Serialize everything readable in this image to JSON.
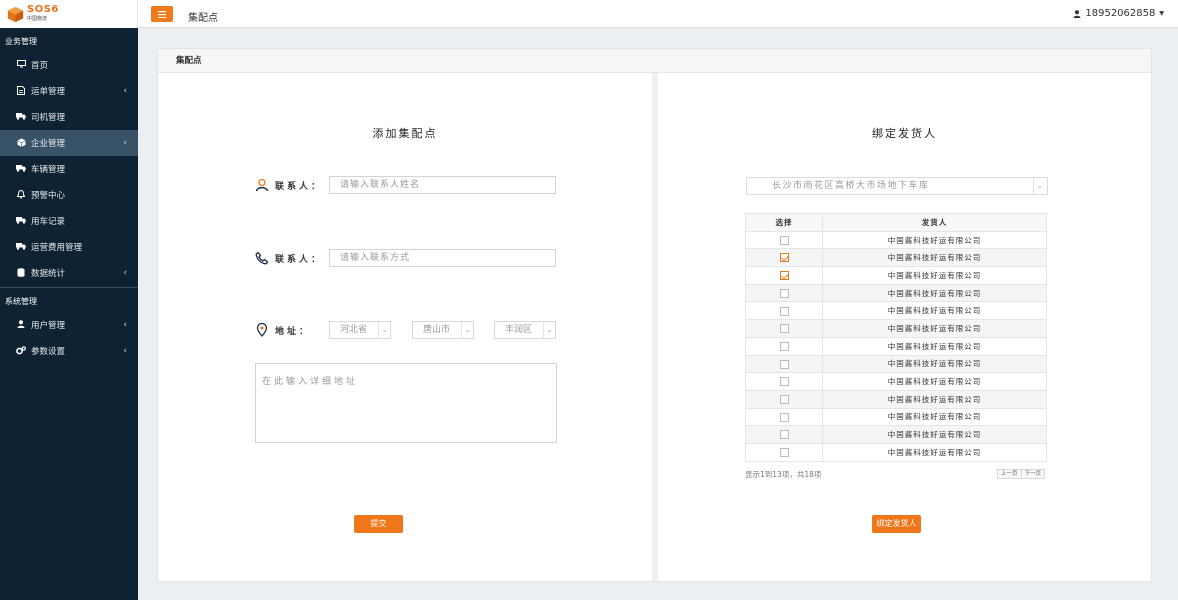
{
  "brand": {
    "logo_text": "SOS6",
    "logo_sub": "中国物流",
    "accent": "#f0761a",
    "sidebar_bg": "#0f2233"
  },
  "header": {
    "page_title": "集配点",
    "user": "18952062858"
  },
  "sidebar": {
    "section_business": "业务管理",
    "business_items": [
      {
        "label": "首页",
        "icon": "monitor-icon",
        "has_arrow": false
      },
      {
        "label": "运单管理",
        "icon": "document-icon",
        "has_arrow": true
      },
      {
        "label": "司机管理",
        "icon": "truck-icon",
        "has_arrow": false
      },
      {
        "label": "企业管理",
        "icon": "cube-icon",
        "has_arrow": true,
        "active": true
      },
      {
        "label": "车辆管理",
        "icon": "truck-icon",
        "has_arrow": false
      },
      {
        "label": "预警中心",
        "icon": "bell-icon",
        "has_arrow": false
      },
      {
        "label": "用车记录",
        "icon": "truck-icon",
        "has_arrow": false
      },
      {
        "label": "运营费用管理",
        "icon": "truck-icon",
        "has_arrow": false
      },
      {
        "label": "数据统计",
        "icon": "database-icon",
        "has_arrow": true
      }
    ],
    "section_system": "系统管理",
    "system_items": [
      {
        "label": "用户管理",
        "icon": "user-icon",
        "has_arrow": true
      },
      {
        "label": "参数设置",
        "icon": "gears-icon",
        "has_arrow": true
      }
    ],
    "arrow": "‹"
  },
  "card": {
    "header": "集配点"
  },
  "left_panel": {
    "title": "添加集配点",
    "contact_name_label": "联系人：",
    "contact_name_placeholder": "请输入联系人姓名",
    "contact_phone_label": "联系人：",
    "contact_phone_placeholder": "请输入联系方式",
    "address_label": "地址：",
    "province": "河北省",
    "city": "唐山市",
    "district": "丰润区",
    "detail_placeholder": "在此输入详细地址",
    "submit_label": "提交"
  },
  "right_panel": {
    "title": "绑定发货人",
    "location": "长沙市雨花区高桥大市场地下车库",
    "col_select": "选择",
    "col_shipper": "发货人",
    "rows": [
      {
        "name": "中国酱科技好运有限公司",
        "checked": false
      },
      {
        "name": "中国酱科技好运有限公司",
        "checked": true
      },
      {
        "name": "中国酱科技好运有限公司",
        "checked": true
      },
      {
        "name": "中国酱科技好运有限公司",
        "checked": false
      },
      {
        "name": "中国酱科技好运有限公司",
        "checked": false
      },
      {
        "name": "中国酱科技好运有限公司",
        "checked": false
      },
      {
        "name": "中国酱科技好运有限公司",
        "checked": false
      },
      {
        "name": "中国酱科技好运有限公司",
        "checked": false
      },
      {
        "name": "中国酱科技好运有限公司",
        "checked": false
      },
      {
        "name": "中国酱科技好运有限公司",
        "checked": false
      },
      {
        "name": "中国酱科技好运有限公司",
        "checked": false
      },
      {
        "name": "中国酱科技好运有限公司",
        "checked": false
      },
      {
        "name": "中国酱科技好运有限公司",
        "checked": false
      }
    ],
    "pager_info": "显示1到13项，共18项",
    "prev_label": "上一页",
    "next_label": "下一页",
    "bind_label": "绑定发货人"
  }
}
